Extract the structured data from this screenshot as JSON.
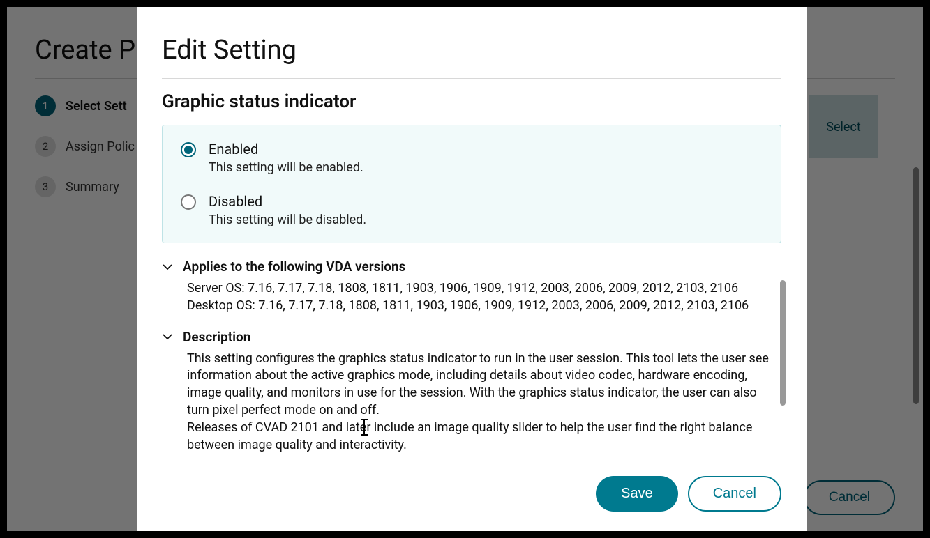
{
  "background": {
    "title": "Create P",
    "select_label": "Select",
    "cancel_label": "Cancel",
    "steps": [
      {
        "num": "1",
        "label": "Select Sett"
      },
      {
        "num": "2",
        "label": "Assign Polic"
      },
      {
        "num": "3",
        "label": "Summary"
      }
    ]
  },
  "modal": {
    "title": "Edit Setting",
    "setting_name": "Graphic status indicator",
    "options": {
      "enabled": {
        "label": "Enabled",
        "sub": "This setting will be enabled."
      },
      "disabled": {
        "label": "Disabled",
        "sub": "This setting will be disabled."
      }
    },
    "vda_section": {
      "title": "Applies to the following VDA versions",
      "server": "Server OS: 7.16, 7.17, 7.18, 1808, 1811, 1903, 1906, 1909, 1912, 2003, 2006, 2009, 2012, 2103, 2106",
      "desktop": "Desktop OS: 7.16, 7.17, 7.18, 1808, 1811, 1903, 1906, 1909, 1912, 2003, 2006, 2009, 2012, 2103, 2106"
    },
    "desc_section": {
      "title": "Description",
      "p1": "This setting configures the graphics status indicator to run in the user session. This tool lets the user see information about the active graphics mode, including details about video codec, hardware encoding, image quality, and monitors in use for the session. With the graphics status indicator, the user can also turn pixel perfect mode on and off.",
      "p2": "Releases of CVAD 2101 and later include an image quality slider to help the user find the right balance between image quality and interactivity."
    },
    "save_label": "Save",
    "cancel_label": "Cancel"
  }
}
